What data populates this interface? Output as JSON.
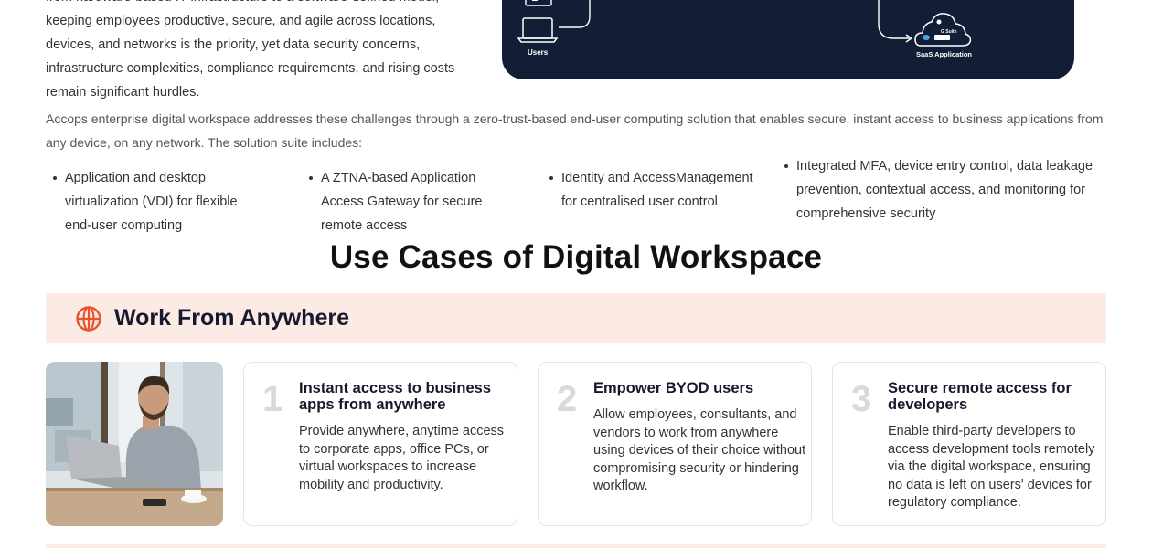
{
  "intro": {
    "lines": [
      "from hardware-based IT infrastructure to a software-defined model,",
      "keeping employees productive, secure, and agile across locations,",
      "devices, and networks is the priority, yet data security concerns,",
      "infrastructure complexities, compliance requirements, and rising costs",
      "remain significant hurdles."
    ]
  },
  "diagram": {
    "users_label": "Users",
    "saas_label": "SaaS Application",
    "gsuite_label": "G Suite",
    "bg_color": "#121d36"
  },
  "solution": {
    "text": "Accops enterprise digital workspace addresses these challenges through a zero-trust-based end-user computing solution that enables secure, instant access to business applications from any device, on any network. The solution suite includes:"
  },
  "features": [
    "Application and desktop virtualization (VDI) for flexible end-user computing",
    "A ZTNA-based Application Access Gateway for secure remote access",
    "Identity and AccessManagement for centralised user control",
    "Integrated MFA, device entry control, data leakage prevention, contextual access, and monitoring for comprehensive security"
  ],
  "section_title": "Use Cases of Digital Workspace",
  "banner": {
    "title": "Work From Anywhere",
    "accent_color": "#e8542a",
    "bg_color": "#fceae4"
  },
  "cards": [
    {
      "number": "1",
      "title": "Instant access to business apps from anywhere",
      "description": "Provide anywhere, anytime access to corporate apps, office PCs, or virtual workspaces to increase mobility and productivity."
    },
    {
      "number": "2",
      "title": "Empower BYOD users",
      "description": "Allow employees, consultants, and vendors to work from anywhere using devices of their choice without compromising security or hindering workflow."
    },
    {
      "number": "3",
      "title": "Secure remote access for developers",
      "description": "Enable third-party developers to access development tools remotely via the digital workspace, ensuring no data is left on users' devices for regulatory compliance."
    }
  ]
}
